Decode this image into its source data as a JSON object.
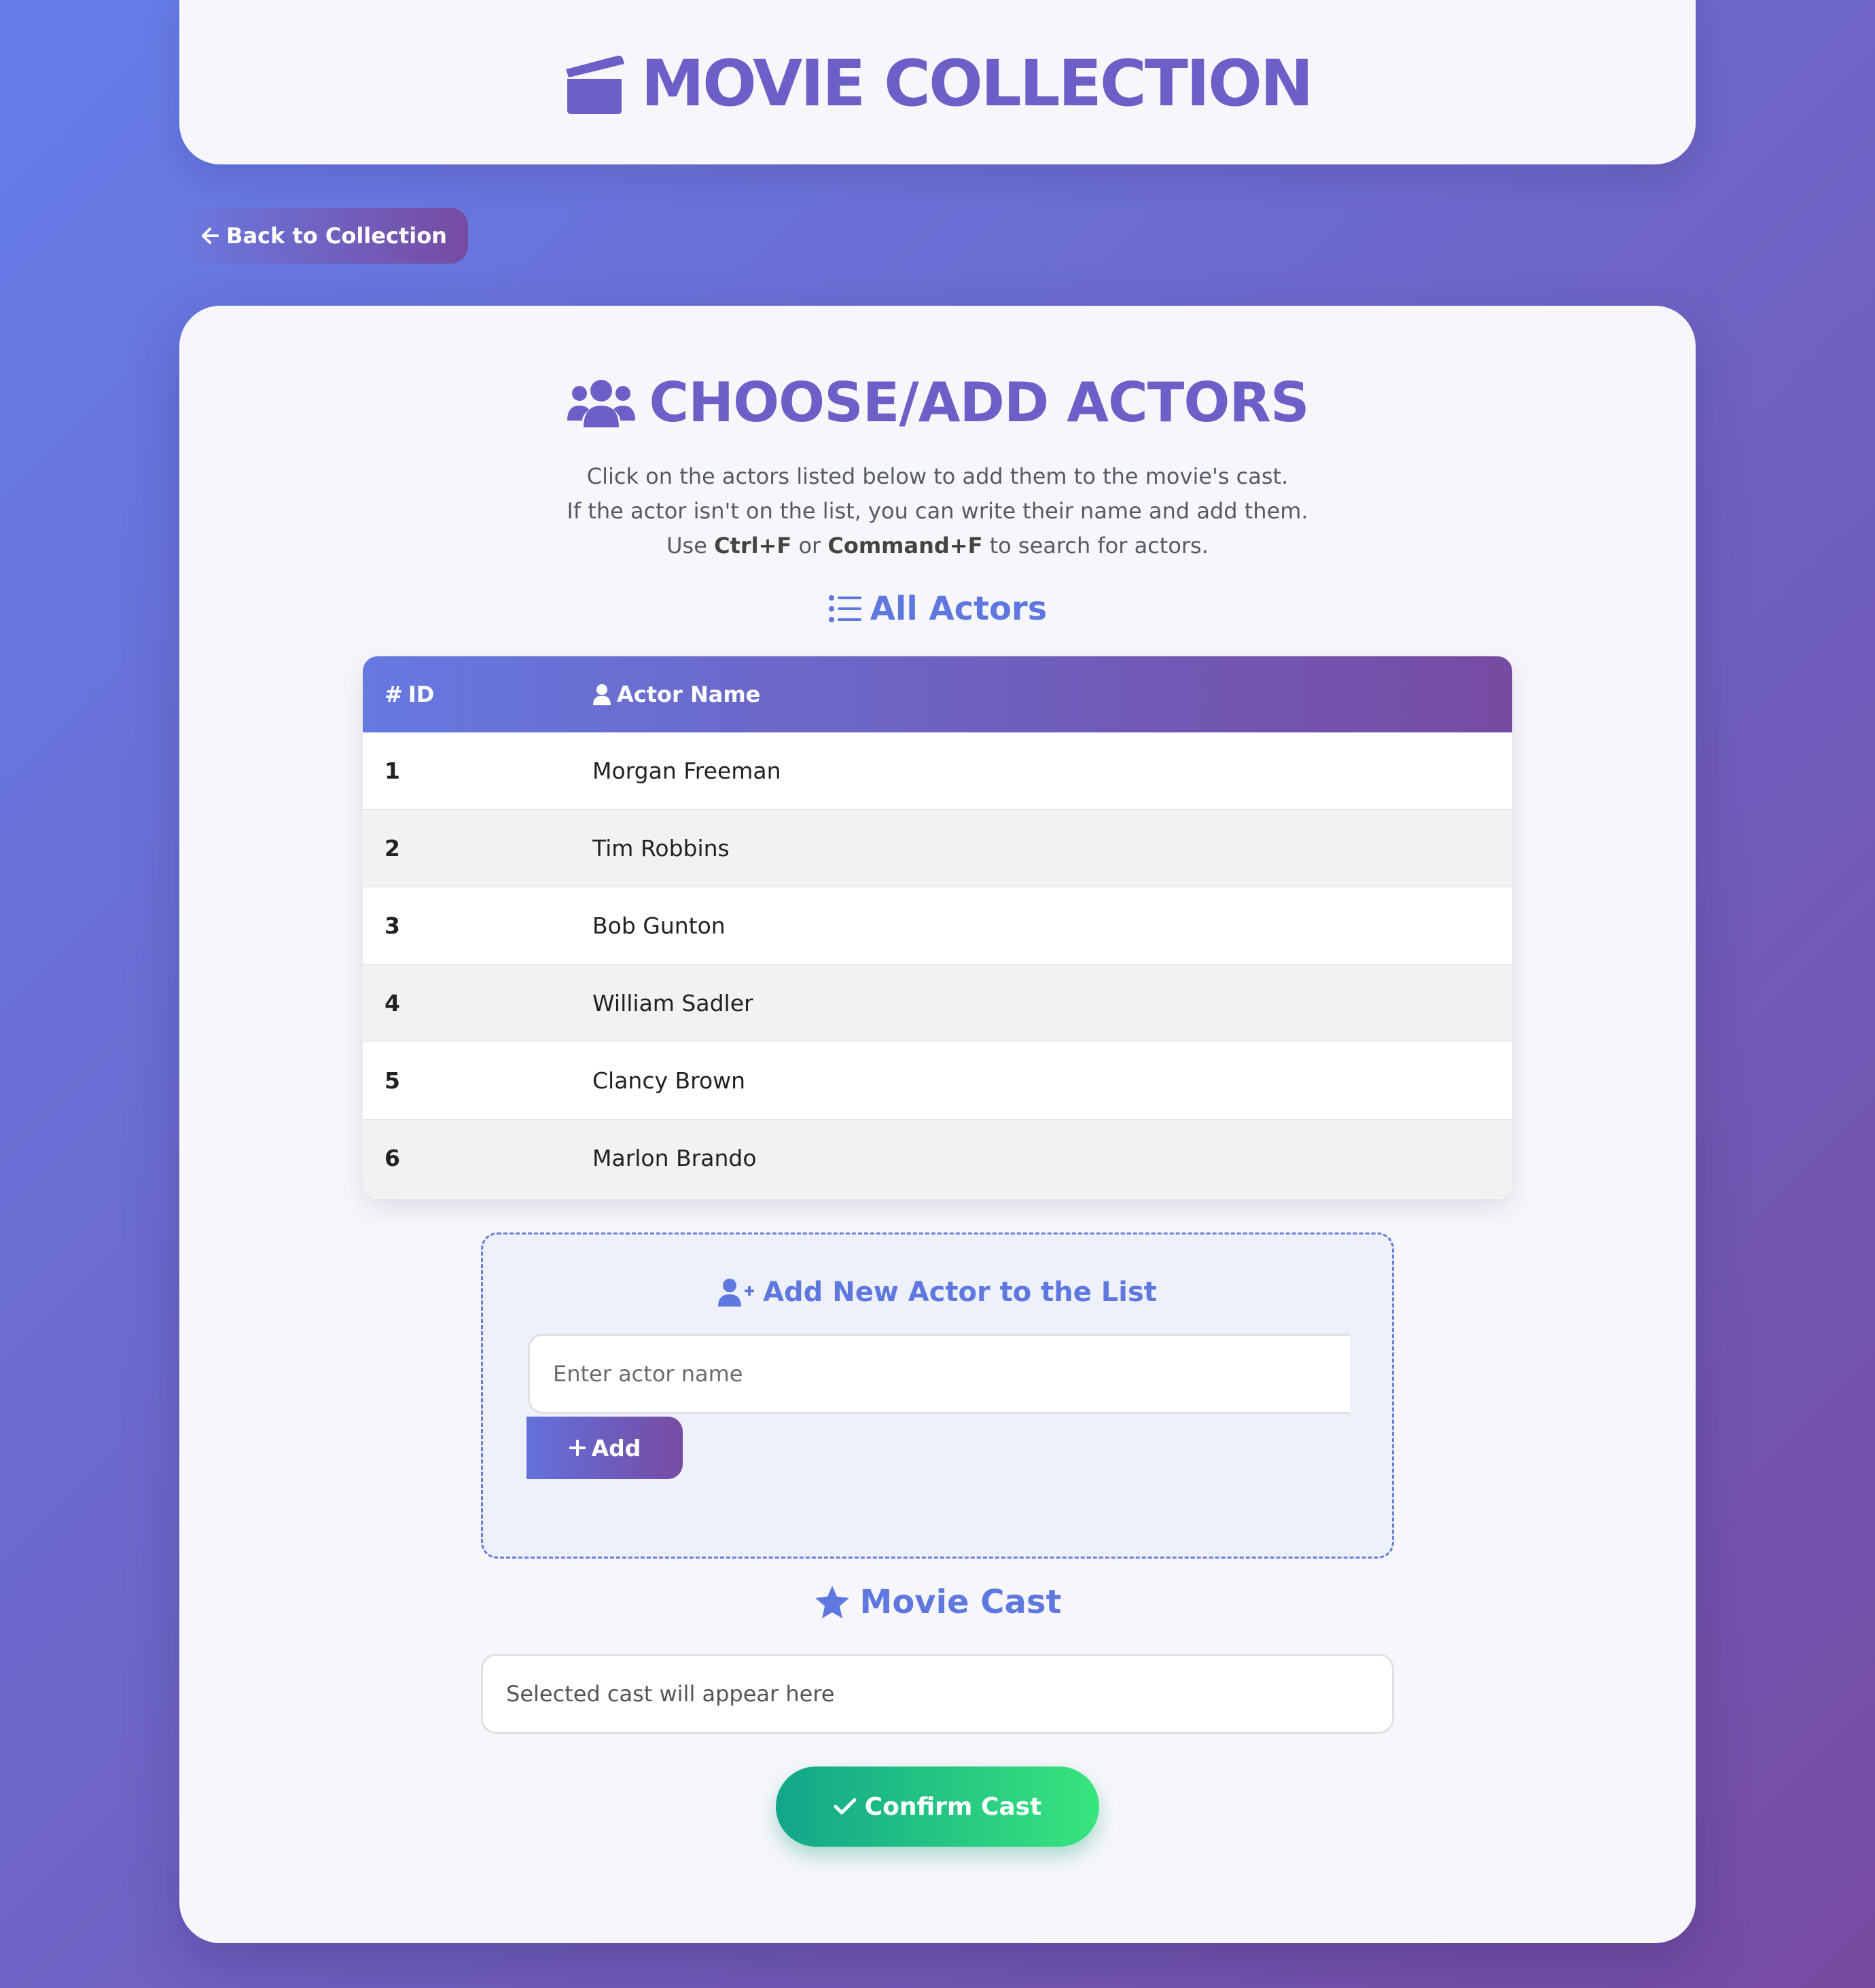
{
  "header": {
    "title": "MOVIE COLLECTION",
    "icon": "clapperboard-icon"
  },
  "nav": {
    "back_label": "Back to Collection",
    "back_icon": "arrow-left-icon"
  },
  "section": {
    "title": "CHOOSE/ADD ACTORS",
    "icon": "users-icon",
    "instructions": {
      "line1": "Click on the actors listed below to add them to the movie's cast.",
      "line2": "If the actor isn't on the list, you can write their name and add them.",
      "line3_pre": "Use ",
      "line3_key1": "Ctrl+F",
      "line3_mid": " or ",
      "line3_key2": "Command+F",
      "line3_post": " to search for actors."
    }
  },
  "actors_table": {
    "title": "All Actors",
    "title_icon": "list-icon",
    "columns": {
      "id": "ID",
      "id_symbol": "#",
      "name": "Actor Name",
      "name_icon": "user-icon"
    },
    "rows": [
      {
        "id": "1",
        "name": "Morgan Freeman"
      },
      {
        "id": "2",
        "name": "Tim Robbins"
      },
      {
        "id": "3",
        "name": "Bob Gunton"
      },
      {
        "id": "4",
        "name": "William Sadler"
      },
      {
        "id": "5",
        "name": "Clancy Brown"
      },
      {
        "id": "6",
        "name": "Marlon Brando"
      }
    ]
  },
  "add_actor": {
    "title": "Add New Actor to the List",
    "title_icon": "user-plus-icon",
    "input_placeholder": "Enter actor name",
    "input_value": "",
    "button_label": "Add",
    "button_icon": "plus-icon"
  },
  "cast": {
    "title": "Movie Cast",
    "title_icon": "star-icon",
    "placeholder": "Selected cast will appear here",
    "confirm_label": "Confirm Cast",
    "confirm_icon": "check-icon"
  },
  "colors": {
    "bg_start": "#667eea",
    "bg_end": "#764ba2",
    "title_purple": "#6c5fc7",
    "accent_blue": "#5f78e0",
    "confirm_start": "#12a58a",
    "confirm_end": "#37e57d",
    "card_bg": "#f7f7fb"
  }
}
